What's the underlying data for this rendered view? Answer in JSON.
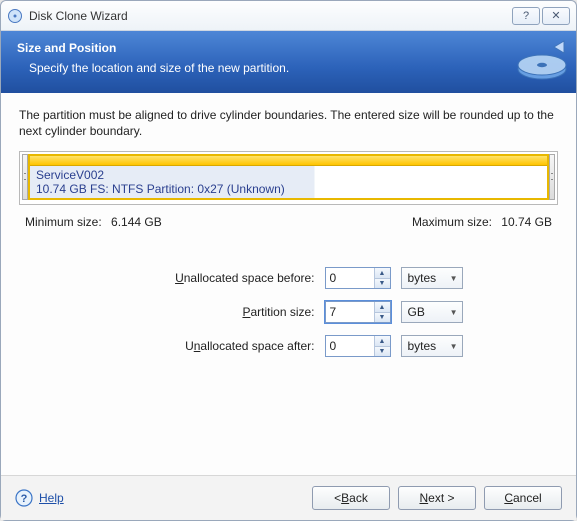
{
  "window": {
    "title": "Disk Clone Wizard"
  },
  "header": {
    "title": "Size and Position",
    "subtitle": "Specify the location and size of the new partition."
  },
  "instruction": "The partition must be aligned to drive cylinder boundaries. The entered size will be rounded up to the next cylinder boundary.",
  "partition": {
    "name": "ServiceV002",
    "details": "10.74 GB  FS: NTFS Partition: 0x27 (Unknown)"
  },
  "sizes": {
    "min_label": "Minimum size:",
    "min_value": "6.144 GB",
    "max_label": "Maximum size:",
    "max_value": "10.74 GB"
  },
  "form": {
    "before_label": "Unallocated space before:",
    "before_value": "0",
    "before_unit": "bytes",
    "size_label": "Partition size:",
    "size_value": "7",
    "size_unit": "GB",
    "after_label": "Unallocated space after:",
    "after_value": "0",
    "after_unit": "bytes"
  },
  "footer": {
    "help": "Help",
    "back": "< Back",
    "next": "Next >",
    "cancel": "Cancel"
  }
}
